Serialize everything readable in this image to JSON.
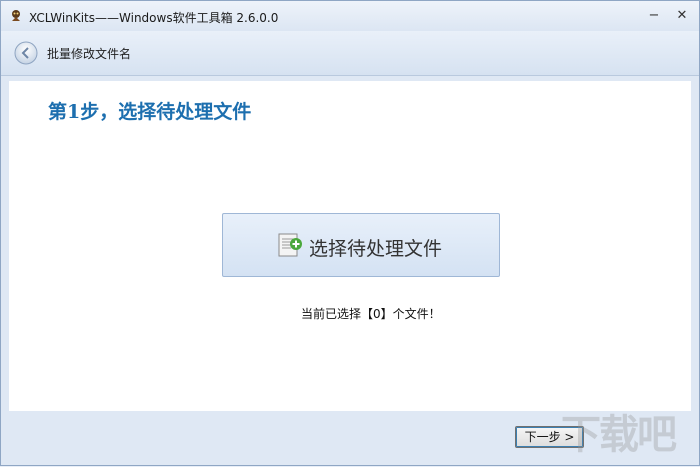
{
  "window": {
    "title": "XCLWinKits——Windows软件工具箱 2.6.0.0",
    "minimize_glyph": "−",
    "close_glyph": "✕"
  },
  "nav": {
    "title": "批量修改文件名",
    "back_icon": "back-arrow-icon"
  },
  "main": {
    "step_title": "第1步，选择待处理文件",
    "select_button_label": "选择待处理文件",
    "select_button_icon": "add-file-icon",
    "status_text": "当前已选择【0】个文件！"
  },
  "footer": {
    "next_label": "下一步 >"
  },
  "watermark": {
    "text": "下载吧"
  },
  "colors": {
    "accent": "#1d6faf",
    "background": "#dfe8f4",
    "panel": "#ffffff"
  }
}
